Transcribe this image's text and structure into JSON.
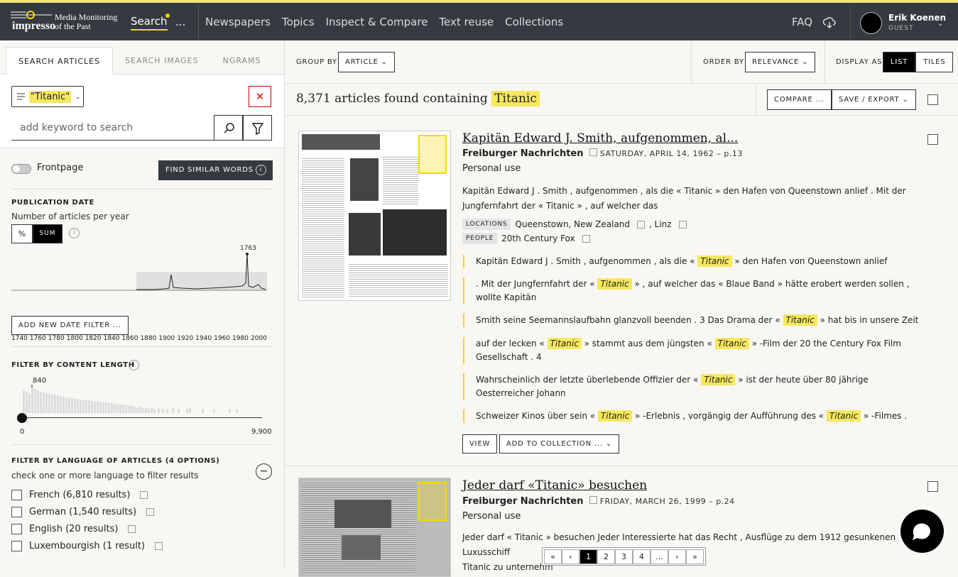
{
  "header": {
    "logo_main": "impresso",
    "logo_tagline_1": "Media Monitoring",
    "logo_tagline_2": "of the Past",
    "search": "Search",
    "more": "...",
    "nav": [
      "Newspapers",
      "Topics",
      "Inspect & Compare",
      "Text reuse",
      "Collections"
    ],
    "faq": "FAQ",
    "user_name": "Erik Koenen",
    "user_role": "GUEST",
    "accent": "#f5d90a"
  },
  "sidebar": {
    "tabs": [
      "SEARCH ARTICLES",
      "SEARCH IMAGES",
      "NGRAMS"
    ],
    "query_pill": "\"Titanic\"",
    "keyword_placeholder": "add keyword to search",
    "frontpage": "Frontpage",
    "find_similar": "FIND SIMILAR WORDS",
    "pubdate": {
      "title": "PUBLICATION DATE",
      "subtitle": "Number of articles per year",
      "mode_pct": "%",
      "mode_sum": "SUM",
      "peak_label": "1763",
      "ticks": [
        "1740",
        "1760",
        "1780",
        "1800",
        "1820",
        "1840",
        "1860",
        "1880",
        "1900",
        "1920",
        "1940",
        "1960",
        "1980",
        "2000"
      ],
      "add_filter": "ADD NEW DATE FILTER ..."
    },
    "length": {
      "title": "FILTER BY CONTENT LENGTH",
      "peak_label": "840",
      "min": "0",
      "max": "9,900"
    },
    "language": {
      "title": "FILTER BY LANGUAGE OF ARTICLES (4 OPTIONS)",
      "subtitle": "check one or more language to filter results",
      "items": [
        "French (6,810 results)",
        "German (1,540 results)",
        "English (20 results)",
        "Luxembourgish (1 result)"
      ]
    }
  },
  "toolbar": {
    "group_by": "GROUP BY",
    "group_value": "ARTICLE",
    "order_by": "ORDER BY",
    "order_value": "RELEVANCE",
    "display_as": "DISPLAY AS",
    "list": "LIST",
    "tiles": "TILES",
    "count_text": "8,371 articles found containing",
    "count_term": "Titanic",
    "compare": "COMPARE ...",
    "save_export": "SAVE / EXPORT"
  },
  "results": [
    {
      "title": "Kapitän Edward J. Smith, aufgenommen, al...",
      "newspaper": "Freiburger Nachrichten",
      "date": "SATURDAY, APRIL 14, 1962 – p.13",
      "rights": "Personal use",
      "excerpt": "Kapitän Edward J . Smith , aufgenommen , als die « Titanic » den Hafen von Queenstown anlief . Mit der Jungfernfahrt der « Titanic » , auf welcher das",
      "locations_label": "LOCATIONS",
      "locations": "Queenstown, New Zealand",
      "locations_2": ", Linz",
      "people_label": "PEOPLE",
      "people": "20th Century Fox",
      "matches": [
        {
          "pre": "Kapitän Edward J . Smith , aufgenommen , als die « ",
          "term": "Titanic",
          "post": " » den Hafen von Queenstown anlief"
        },
        {
          "pre": ". Mit der Jungfernfahrt der « ",
          "term": "Titanic",
          "post": " » , auf welcher das « Blaue Band » hätte erobert werden sollen , wollte Kapitän"
        },
        {
          "pre": "Smith seine Seemannslaufbahn glanzvoll beenden . 3 Das Drama der « ",
          "term": "Titanic",
          "post": " » hat bis in unsere Zeit"
        },
        {
          "pre": "auf der lecken « ",
          "term": "Titanic",
          "mid": " » stammt aus dem jüngsten « ",
          "term2": "Titanic",
          "post": " » -Film der 20 the Century Fox Film Gesellschaft . 4"
        },
        {
          "pre": "Wahrscheinlich der letzte überlebende Offizier der « ",
          "term": "Titanic",
          "post": " » ist der heute über 80 jährige Oesterreicher Johann"
        },
        {
          "pre": "Schweizer Kinos über sein « ",
          "term": "Titanic",
          "mid": " » -Erlebnis , vorgängig der Aufführung des « ",
          "term2": "Titanic",
          "post": " » -Filmes ."
        }
      ],
      "view": "VIEW",
      "add_collection": "ADD TO COLLECTION ..."
    },
    {
      "title": "Jeder darf «Titanic» besuchen",
      "newspaper": "Freiburger Nachrichten",
      "date": "FRIDAY, MARCH 26, 1999 – p.24",
      "rights": "Personal use",
      "excerpt_1": "Jeder darf « Titanic » besuchen Jeder Interessierte hat das Recht , Ausflüge zu dem 1912 gesunkenen Luxusschiff",
      "excerpt_2": "Titanic zu unternehm"
    }
  ],
  "pager": [
    "«",
    "‹",
    "1",
    "2",
    "3",
    "4",
    "...",
    "›",
    "»"
  ],
  "pager_active": "1"
}
